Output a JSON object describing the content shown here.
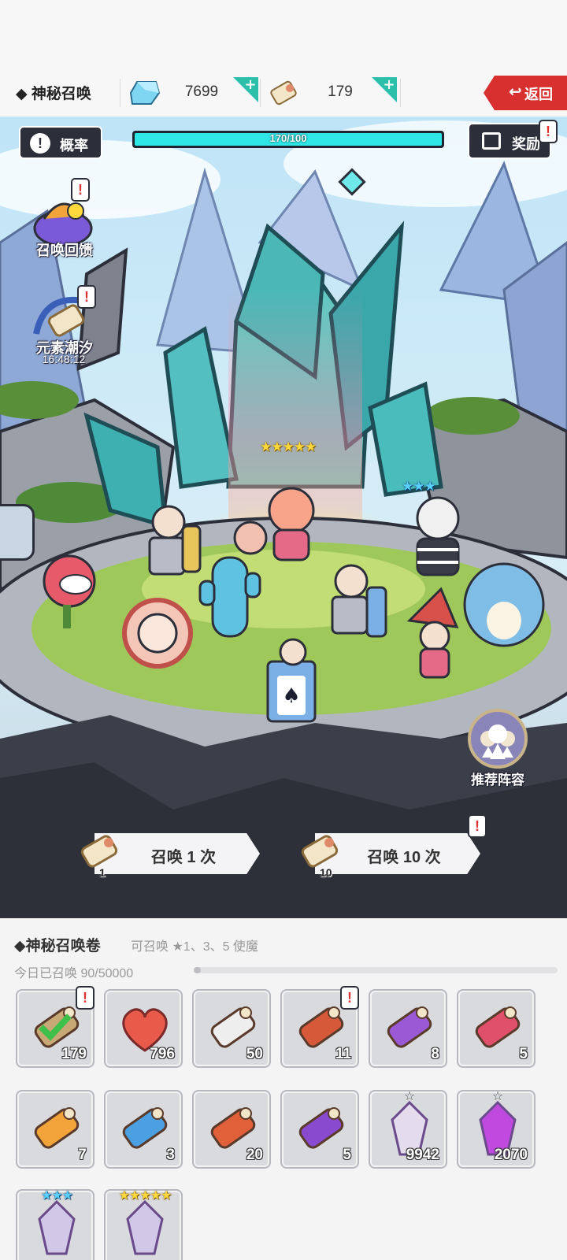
{
  "topbar": {
    "title": "◆ 神秘召唤",
    "gems": "7699",
    "scrolls": "179",
    "back_label": "返回",
    "icons": [
      "gem-icon",
      "scroll-icon",
      "plus-icon",
      "return-arrow-icon"
    ]
  },
  "scene": {
    "rate_label": "概率",
    "progress_text": "170/100",
    "progress_fraction": 1.0,
    "reward_label": "奖励",
    "feedback_label": "召唤回馈",
    "tide_label": "元素潮汐",
    "tide_timer": "16:48:12",
    "gold_stars": "★★★★★",
    "blue_stars": "★★★",
    "recommend_label": "推荐阵容",
    "summon_one": "召唤 1 次",
    "summon_one_cost": "1",
    "summon_ten": "召唤 10 次",
    "summon_ten_cost": "10"
  },
  "inventory": {
    "title": "◆神秘召唤卷",
    "subtitle": "可召唤 ★1、3、5 使魔",
    "daily": "今日已召唤 90/50000",
    "daily_fraction": 0.0018,
    "items": [
      {
        "name": "green-check-scroll",
        "count": "179",
        "color": "#c8a874"
      },
      {
        "name": "heart",
        "count": "796",
        "color": "#e85a4a"
      },
      {
        "name": "white-scroll",
        "count": "50",
        "color": "#eeeeee"
      },
      {
        "name": "red-gold-scroll",
        "count": "11",
        "color": "#d65a3a"
      },
      {
        "name": "purple-scroll",
        "count": "8",
        "color": "#9a5ad6"
      },
      {
        "name": "pink-scroll",
        "count": "5",
        "color": "#e0506a"
      },
      {
        "name": "orange-scroll",
        "count": "7",
        "color": "#f2a43a"
      },
      {
        "name": "blue-scroll",
        "count": "3",
        "color": "#4aa0e0"
      },
      {
        "name": "red-chest-scroll",
        "count": "20",
        "color": "#e0603a"
      },
      {
        "name": "purple-chest-scroll",
        "count": "5",
        "color": "#8a4ad0"
      },
      {
        "name": "white-crystal",
        "count": "9942",
        "color": "#e4dcec"
      },
      {
        "name": "purple-crystal",
        "count": "2070",
        "color": "#c04ae0"
      },
      {
        "name": "blue-star-fragment",
        "count": "",
        "stars": "★★★",
        "color": "#d0c8e6"
      },
      {
        "name": "gold-star-fragment",
        "count": "",
        "stars": "★★★★★",
        "color": "#d0c8e6"
      }
    ]
  }
}
